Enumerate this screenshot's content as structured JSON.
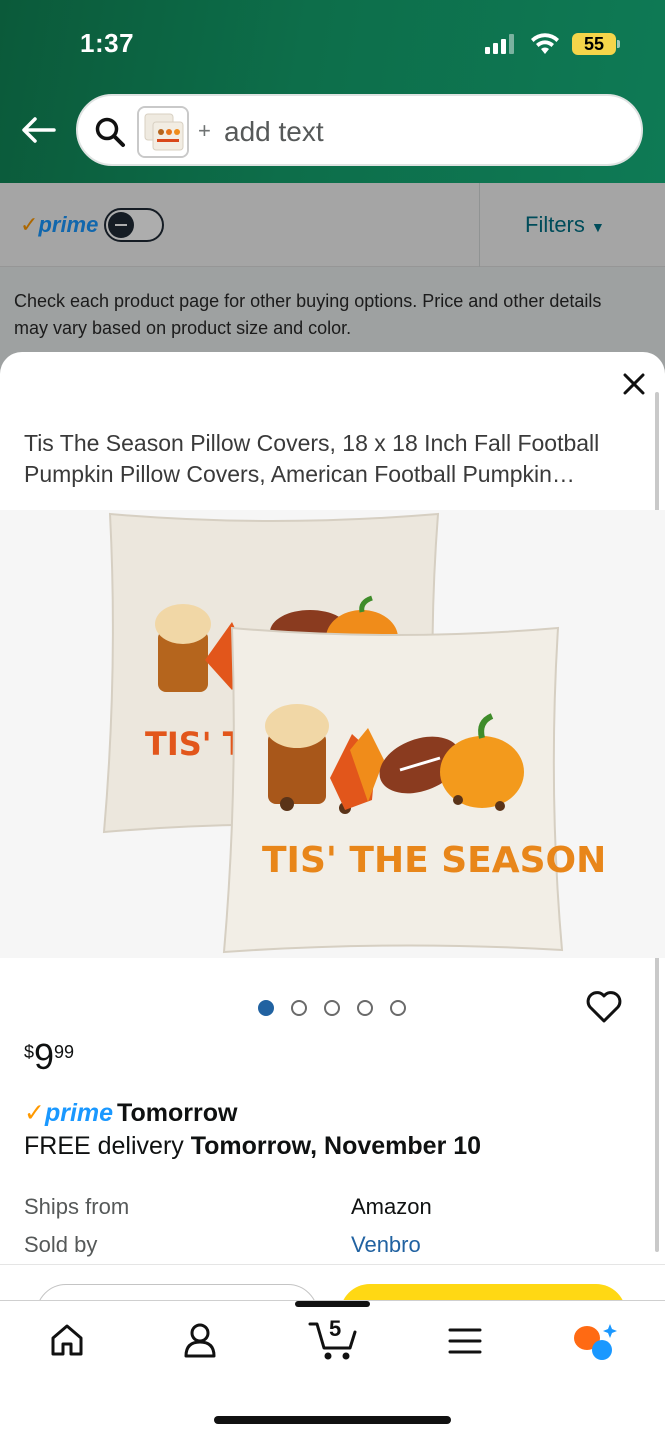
{
  "status_bar": {
    "time": "1:37",
    "battery": "55"
  },
  "search": {
    "plus": "+",
    "placeholder": "add text"
  },
  "filter_bar": {
    "prime_label": "prime",
    "filters_label": "Filters"
  },
  "notice": "Check each product page for other buying options. Price and other details may vary based on product size and color.",
  "product": {
    "title": "Tis The Season Pillow Covers, 18 x 18 Inch Fall Football Pumpkin Pillow Covers, American Football Pumpkin…",
    "image_text": "TIS' THE SEASON",
    "back_pillow_text": "TIS' TH",
    "image_count": 5,
    "active_image": 1,
    "price": {
      "currency": "$",
      "whole": "9",
      "fraction": "99"
    },
    "prime_label": "prime",
    "prime_delivery": "Tomorrow",
    "delivery_prefix": "FREE delivery",
    "delivery_date": "Tomorrow, November 10",
    "ships_from_label": "Ships from",
    "ships_from_value": "Amazon",
    "sold_by_label": "Sold by",
    "sold_by_value": "Venbro"
  },
  "bottom_nav": {
    "cart_count": "5",
    "items": [
      "home-icon",
      "account-icon",
      "cart-icon",
      "menu-icon",
      "rufus-icon"
    ]
  },
  "colors": {
    "header_green": "#0d6e4a",
    "prime_blue": "#1a98ff",
    "amazon_orange": "#ff9900",
    "link_blue": "#2162a1",
    "buy_yellow": "#ffd814"
  }
}
